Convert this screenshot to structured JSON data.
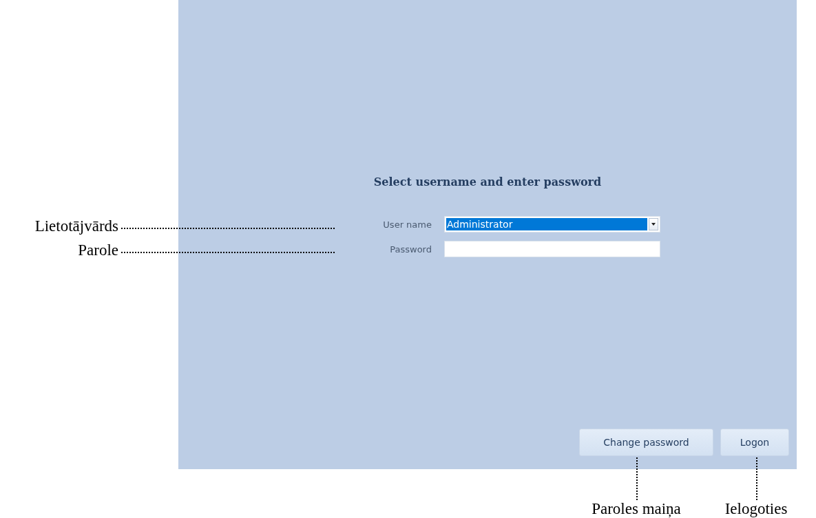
{
  "dialog": {
    "title": "Select username and enter password",
    "fields": [
      {
        "kind": "dropdown",
        "label": "User name",
        "value": "Administrator",
        "value_selected": true,
        "annotation": "Lietotājvārds"
      },
      {
        "kind": "password",
        "label": "Password",
        "annotation": "Parole"
      }
    ],
    "buttons": [
      {
        "label": "Change password",
        "annotation": "Paroles maiņa"
      },
      {
        "label": "Logon",
        "annotation": "Ielogoties"
      }
    ]
  }
}
